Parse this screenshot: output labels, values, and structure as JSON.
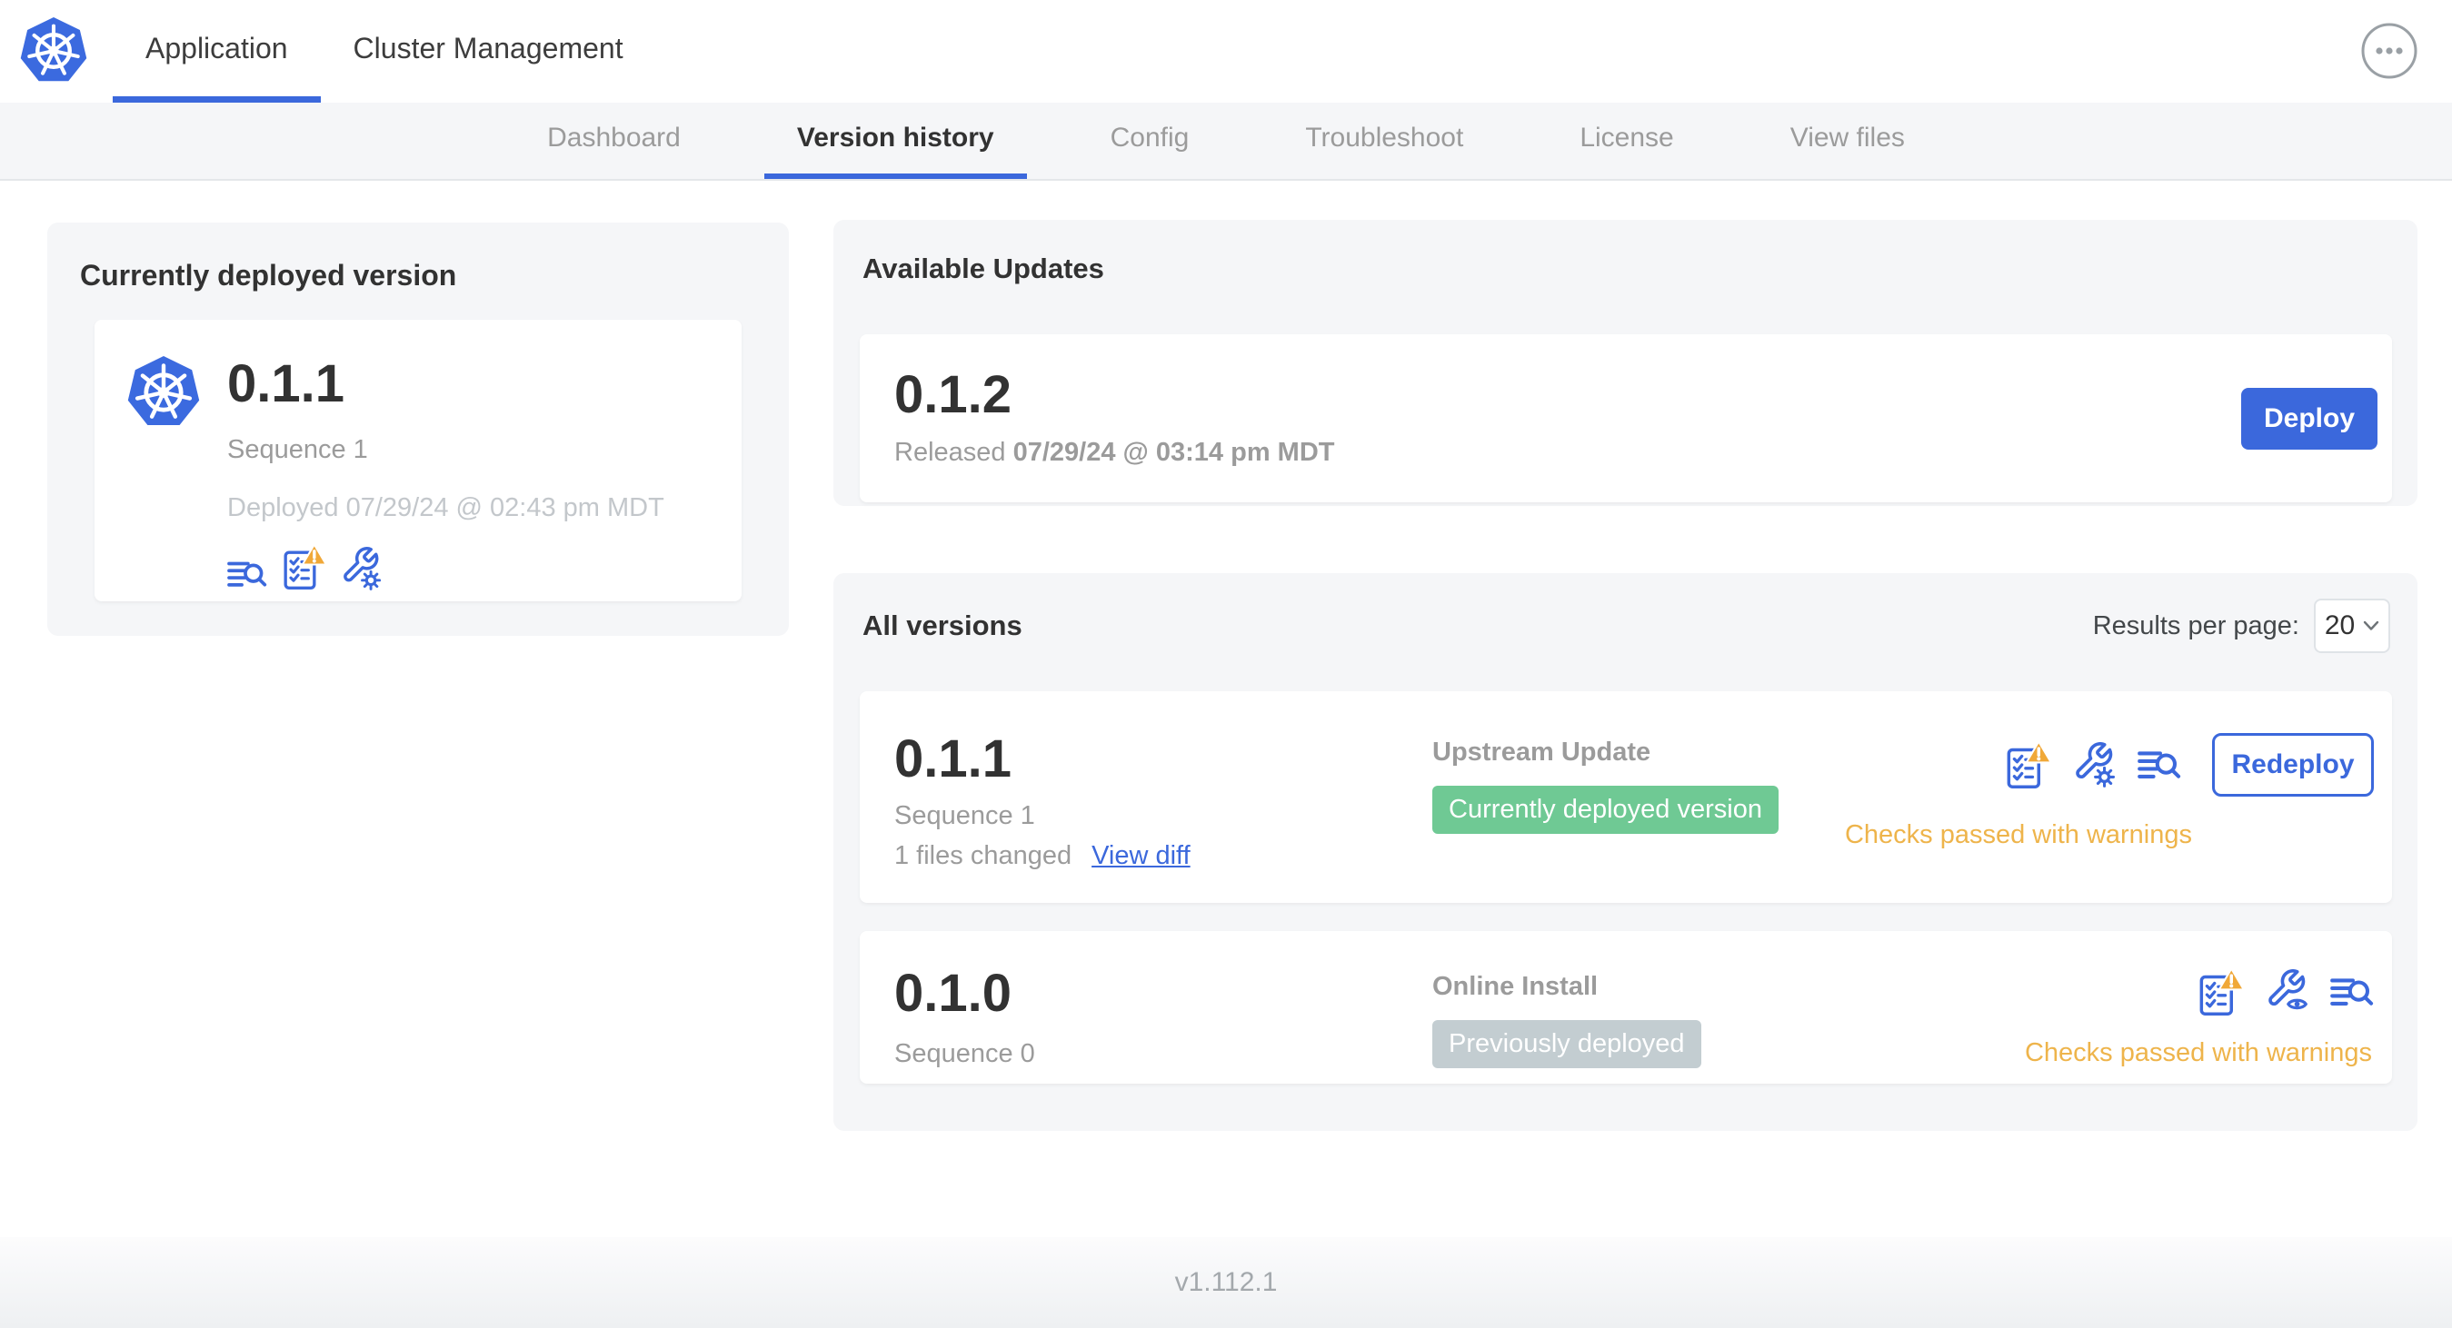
{
  "colors": {
    "accent_blue": "#3B68DC",
    "warning_orange": "#EEB44B",
    "badge_green": "#6FC994",
    "badge_gray": "#C3CDD1",
    "card_gray": "#F5F6F8"
  },
  "top_nav": {
    "tabs": [
      {
        "label": "Application"
      },
      {
        "label": "Cluster Management"
      }
    ]
  },
  "sub_nav": {
    "tabs": [
      "Dashboard",
      "Version history",
      "Config",
      "Troubleshoot",
      "License",
      "View files"
    ]
  },
  "current_version": {
    "title": "Currently deployed version",
    "version": "0.1.1",
    "sequence": "Sequence 1",
    "deployed": "Deployed 07/29/24 @ 02:43 pm MDT"
  },
  "available_updates": {
    "title": "Available Updates",
    "version": "0.1.2",
    "released_prefix": "Released",
    "released_date": "07/29/24 @ 03:14 pm MDT",
    "deploy_label": "Deploy"
  },
  "all_versions": {
    "title": "All versions",
    "results_per_page_label": "Results per page:",
    "results_per_page_value": "20",
    "rows": [
      {
        "version": "0.1.1",
        "sequence": "Sequence 1",
        "files_changed": "1 files changed",
        "view_diff_label": "View diff",
        "source": "Upstream Update",
        "badge": "Currently deployed version",
        "status": "Checks passed with warnings",
        "action_label": "Redeploy"
      },
      {
        "version": "0.1.0",
        "sequence": "Sequence 0",
        "source": "Online Install",
        "badge": "Previously deployed",
        "status": "Checks passed with warnings"
      }
    ]
  },
  "footer": {
    "app_version": "v1.112.1"
  }
}
